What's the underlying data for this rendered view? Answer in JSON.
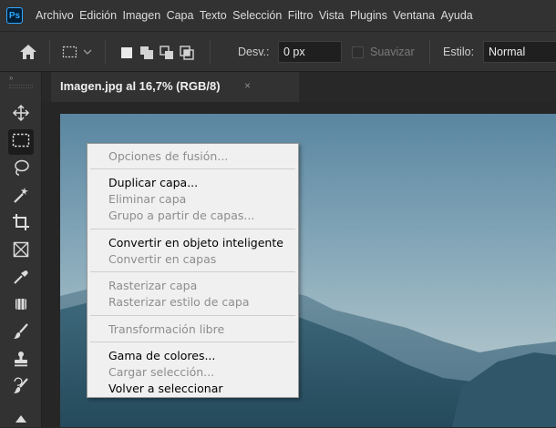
{
  "app": {
    "logo_text": "Ps"
  },
  "menubar": {
    "items": [
      "Archivo",
      "Edición",
      "Imagen",
      "Capa",
      "Texto",
      "Selección",
      "Filtro",
      "Vista",
      "Plugins",
      "Ventana",
      "Ayuda"
    ]
  },
  "options_bar": {
    "feather_label": "Desv.:",
    "feather_value": "0 px",
    "antialias_label": "Suavizar",
    "style_label": "Estilo:",
    "style_value": "Normal"
  },
  "document_tab": {
    "title": "Imagen.jpg al 16,7% (RGB/8)",
    "close_glyph": "×"
  },
  "context_menu": {
    "items": [
      {
        "label": "Opciones de fusión...",
        "enabled": false
      },
      {
        "label": "Duplicar capa...",
        "enabled": true
      },
      {
        "label": "Eliminar capa",
        "enabled": false
      },
      {
        "label": "Grupo a partir de capas...",
        "enabled": false
      },
      {
        "label": "Convertir en objeto inteligente",
        "enabled": true
      },
      {
        "label": "Convertir en capas",
        "enabled": false
      },
      {
        "label": "Rasterizar capa",
        "enabled": false
      },
      {
        "label": "Rasterizar estilo de capa",
        "enabled": false
      },
      {
        "label": "Transformación libre",
        "enabled": false
      },
      {
        "label": "Gama de colores...",
        "enabled": true
      },
      {
        "label": "Cargar selección...",
        "enabled": false
      },
      {
        "label": "Volver a seleccionar",
        "enabled": true
      }
    ]
  },
  "toolbar": {
    "tools": [
      "move-tool",
      "rectangular-marquee-tool",
      "lasso-tool",
      "magic-wand-tool",
      "crop-tool",
      "frame-tool",
      "eyedropper-tool",
      "spot-healing-tool",
      "brush-tool",
      "clone-stamp-tool",
      "history-brush-tool"
    ]
  },
  "colors": {
    "panel": "#323232",
    "background": "#282828",
    "menu_bg": "#f0f0f0",
    "disabled_text": "#8d8d8d",
    "sky_top": "#5f8aa4",
    "sky_bottom": "#b7c9cd",
    "mountain": "#3a6375"
  }
}
